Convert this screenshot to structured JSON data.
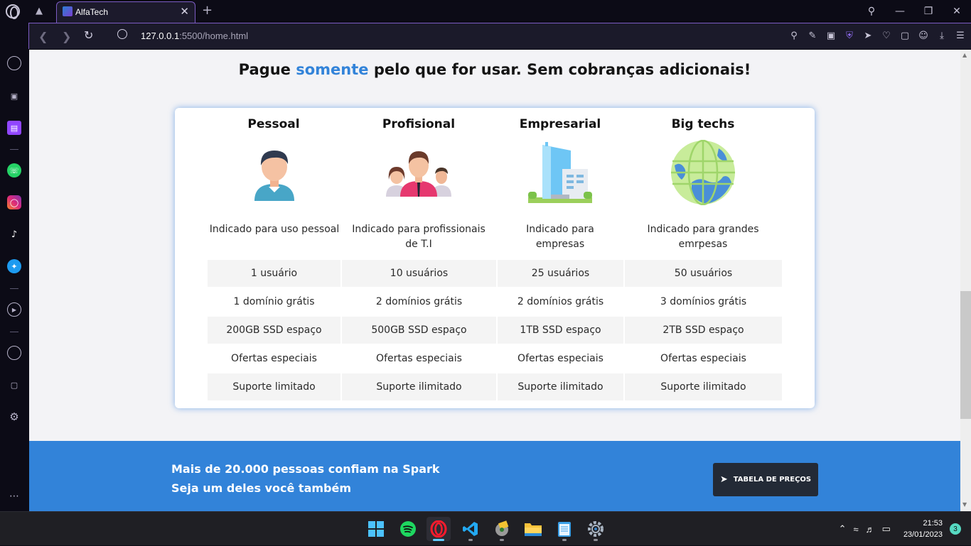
{
  "browser": {
    "tab_title": "AlfaTech",
    "url_host": "127.0.0.1",
    "url_rest": ":5500/home.html",
    "accent": "#7c5cc4"
  },
  "page": {
    "headline_pre": "Pague ",
    "headline_highlight": "somente",
    "headline_post": " pelo que for usar. Sem cobranças adicionais!",
    "highlight_color": "#3283d9",
    "plans": [
      {
        "name": "Pessoal",
        "icon": "person-illustration",
        "desc": "Indicado para uso pessoal",
        "users": "1 usuário",
        "domains": "1 domínio grátis",
        "storage": "200GB SSD espaço",
        "offers": "Ofertas especiais",
        "support": "Suporte limitado"
      },
      {
        "name": "Profisional",
        "icon": "team-illustration",
        "desc": "Indicado para profissionais de T.I",
        "users": "10 usuários",
        "domains": "2 domínios grátis",
        "storage": "500GB SSD espaço",
        "offers": "Ofertas especiais",
        "support": "Suporte ilimitado"
      },
      {
        "name": "Empresarial",
        "icon": "building-illustration",
        "desc": "Indicado para empresas",
        "users": "25 usuários",
        "domains": "2 domínios grátis",
        "storage": "1TB SSD espaço",
        "offers": "Ofertas especiais",
        "support": "Suporte ilimitado"
      },
      {
        "name": "Big techs",
        "icon": "globe-illustration",
        "desc": "Indicado para grandes emrpesas",
        "users": "50 usuários",
        "domains": "3 domínios grátis",
        "storage": "2TB SSD espaço",
        "offers": "Ofertas especiais",
        "support": "Suporte ilimitado"
      }
    ],
    "cta": {
      "line1": "Mais de 20.000 pessoas confiam na Spark",
      "line2": "Seja um deles você também",
      "button": "TABELA DE PREÇOS",
      "bg": "#3283d9"
    }
  },
  "taskbar": {
    "time": "21:53",
    "date": "23/01/2023",
    "notifications": "3"
  }
}
